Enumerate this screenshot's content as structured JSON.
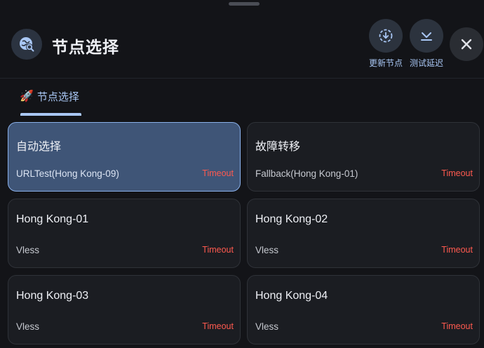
{
  "header": {
    "title": "节点选择",
    "actions": [
      {
        "label": "更新节点",
        "icon": "download-circle-icon"
      },
      {
        "label": "测试延迟",
        "icon": "latency-test-icon"
      }
    ],
    "close_icon": "close-icon"
  },
  "tabs": [
    {
      "label": "节点选择",
      "icon": "🚀",
      "selected": true
    }
  ],
  "colors": {
    "accent": "#a9c7f5",
    "selected_card": "#3f5577",
    "timeout": "#ff5a4f",
    "background": "#131418"
  },
  "cards": [
    {
      "name": "自动选择",
      "type": "URLTest(Hong Kong-09)",
      "delay": "Timeout",
      "selected": true
    },
    {
      "name": "故障转移",
      "type": "Fallback(Hong Kong-01)",
      "delay": "Timeout",
      "selected": false
    },
    {
      "name": "Hong Kong-01",
      "type": "Vless",
      "delay": "Timeout",
      "selected": false
    },
    {
      "name": "Hong Kong-02",
      "type": "Vless",
      "delay": "Timeout",
      "selected": false
    },
    {
      "name": "Hong Kong-03",
      "type": "Vless",
      "delay": "Timeout",
      "selected": false
    },
    {
      "name": "Hong Kong-04",
      "type": "Vless",
      "delay": "Timeout",
      "selected": false
    }
  ]
}
